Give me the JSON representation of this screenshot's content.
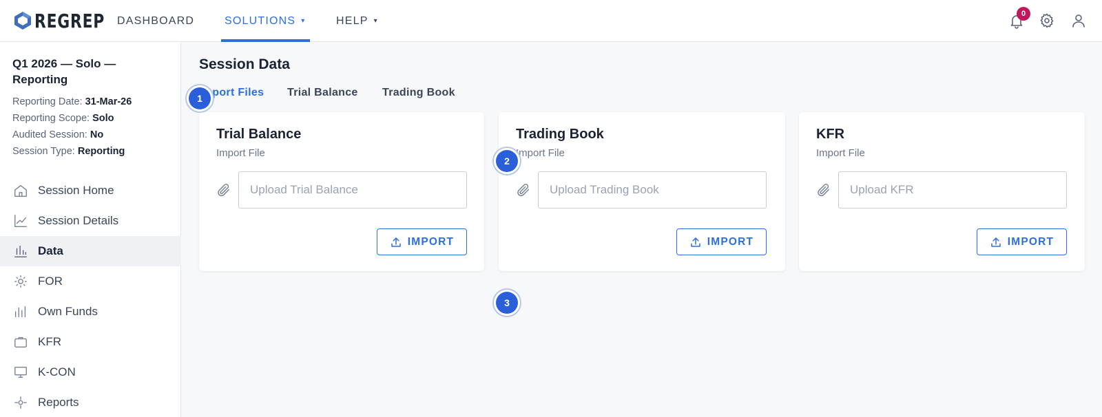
{
  "header": {
    "logo_text": "REGREP",
    "nav": [
      {
        "label": "DASHBOARD"
      },
      {
        "label": "SOLUTIONS",
        "caret": "▾"
      },
      {
        "label": "HELP",
        "caret": "▾"
      }
    ],
    "notification_count": "0",
    "icons": [
      "bell-icon",
      "gear-icon",
      "user-icon"
    ]
  },
  "session": {
    "title": "Q1 2026 — Solo — Reporting",
    "meta": [
      {
        "label": "Reporting Date:",
        "value": "31-Mar-26"
      },
      {
        "label": "Reporting Scope:",
        "value": "Solo"
      },
      {
        "label": "Audited Session:",
        "value": "No"
      },
      {
        "label": "Session Type:",
        "value": "Reporting"
      }
    ]
  },
  "sidebar": {
    "items": [
      {
        "label": "Session Home",
        "icon": "home-icon"
      },
      {
        "label": "Session Details",
        "icon": "line-chart-icon"
      },
      {
        "label": "Data",
        "icon": "bar-chart-icon"
      },
      {
        "label": "FOR",
        "icon": "sun-icon"
      },
      {
        "label": "Own Funds",
        "icon": "bars-icon"
      },
      {
        "label": "KFR",
        "icon": "briefcase-icon"
      },
      {
        "label": "K-CON",
        "icon": "monitor-icon"
      },
      {
        "label": "Reports",
        "icon": "target-icon"
      }
    ]
  },
  "main": {
    "title": "Session Data",
    "tabs": [
      {
        "label": "Import Files"
      },
      {
        "label": "Trial Balance"
      },
      {
        "label": "Trading Book"
      }
    ],
    "cards": [
      {
        "title": "Trial Balance",
        "subtitle": "Import File",
        "placeholder": "Upload Trial Balance",
        "button": "IMPORT"
      },
      {
        "title": "Trading Book",
        "subtitle": "Import File",
        "placeholder": "Upload Trading Book",
        "button": "IMPORT"
      },
      {
        "title": "KFR",
        "subtitle": "Import File",
        "placeholder": "Upload KFR",
        "button": "IMPORT"
      }
    ]
  },
  "steps": [
    "1",
    "2",
    "3"
  ],
  "colors": {
    "accent": "#2b6fe0",
    "badge": "#c2185b",
    "step": "#2b5fd9"
  }
}
